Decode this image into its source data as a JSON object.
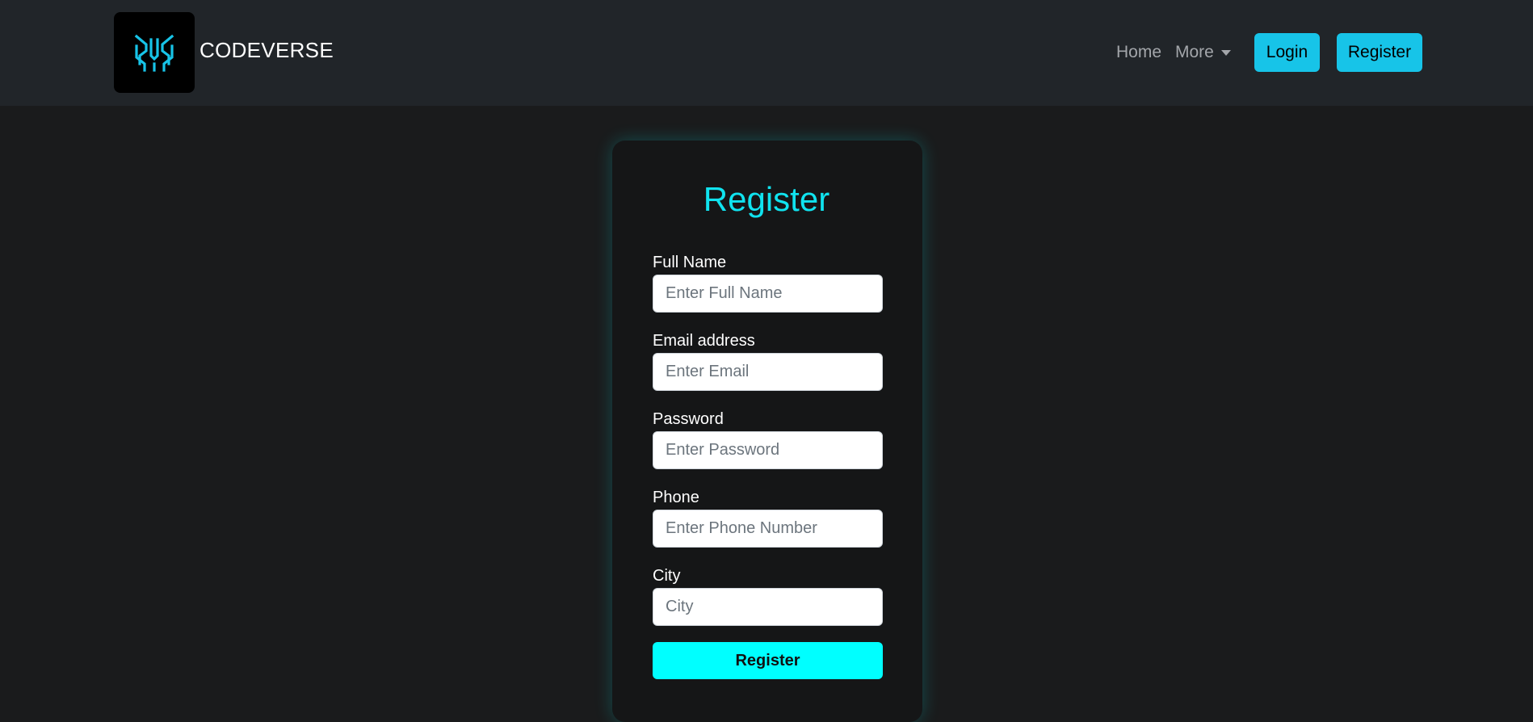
{
  "brand": {
    "name": "CODEVERSE",
    "logo_color": "#17c4e8"
  },
  "nav": {
    "home": "Home",
    "more": "More",
    "login": "Login",
    "register": "Register"
  },
  "form": {
    "title": "Register",
    "fields": [
      {
        "label": "Full Name",
        "placeholder": "Enter Full Name",
        "value": ""
      },
      {
        "label": "Email address",
        "placeholder": "Enter Email",
        "value": ""
      },
      {
        "label": "Password",
        "placeholder": "Enter Password",
        "value": ""
      },
      {
        "label": "Phone",
        "placeholder": "Enter Phone Number",
        "value": ""
      },
      {
        "label": "City",
        "placeholder": "City",
        "value": ""
      }
    ],
    "submit": "Register"
  },
  "colors": {
    "accent": "#17c4e8",
    "title": "#10e3ef",
    "submit": "#00ffff",
    "navbar": "#212529",
    "background": "#1a1b1c"
  }
}
